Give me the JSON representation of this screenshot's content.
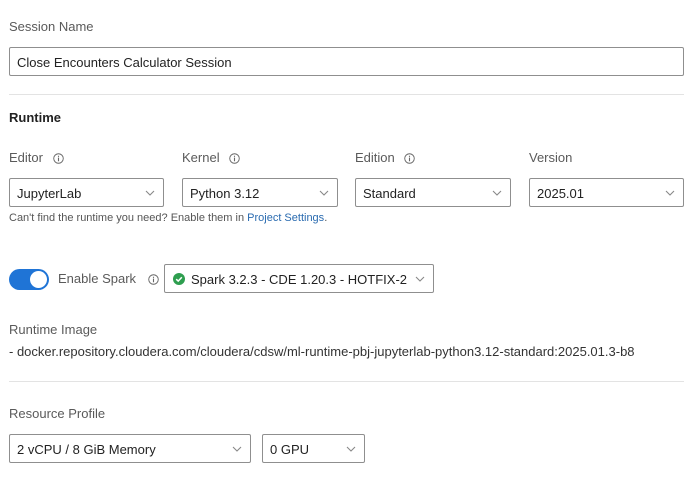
{
  "session": {
    "label": "Session Name",
    "value": "Close Encounters Calculator Session"
  },
  "runtime": {
    "heading": "Runtime",
    "editor": {
      "label": "Editor",
      "value": "JupyterLab"
    },
    "kernel": {
      "label": "Kernel",
      "value": "Python 3.12"
    },
    "edition": {
      "label": "Edition",
      "value": "Standard"
    },
    "version": {
      "label": "Version",
      "value": "2025.01"
    },
    "hint_text": "Can't find the runtime you need? Enable them in ",
    "hint_link": "Project Settings",
    "hint_end": "."
  },
  "spark": {
    "toggle_label": "Enable Spark",
    "enabled": true,
    "value": "Spark 3.2.3 - CDE 1.20.3 - HOTFIX-2",
    "status_color": "#2e9e4f"
  },
  "runtime_image": {
    "label": "Runtime Image",
    "value": "- docker.repository.cloudera.com/cloudera/cdsw/ml-runtime-pbj-jupyterlab-python3.12-standard:2025.01.3-b8"
  },
  "resource_profile": {
    "label": "Resource Profile",
    "cpu_memory": "2 vCPU / 8 GiB Memory",
    "gpu": "0 GPU"
  },
  "colors": {
    "accent": "#1f74d6",
    "link": "#2a6bb0"
  }
}
